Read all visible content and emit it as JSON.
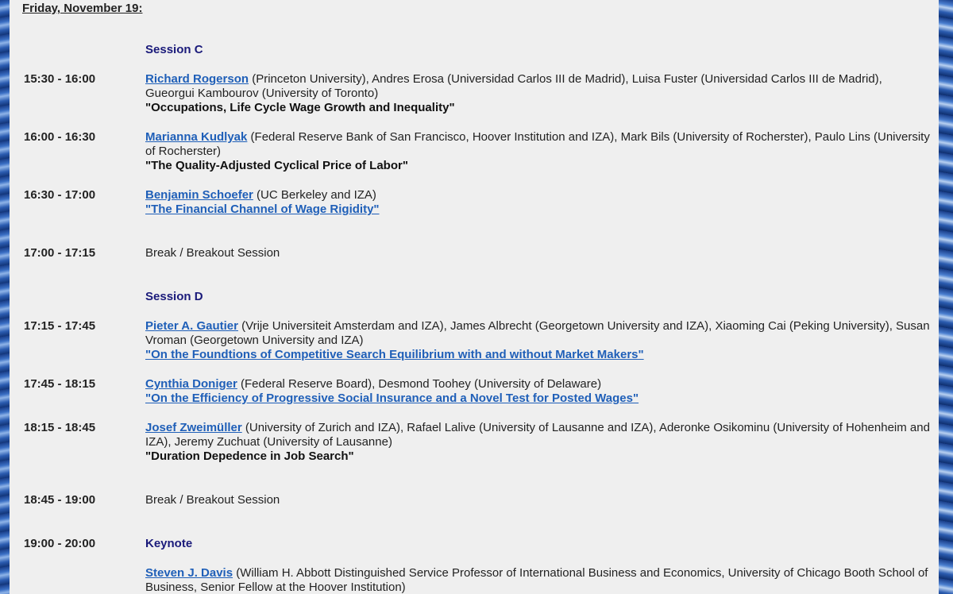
{
  "day_heading": "Friday, November 19:",
  "session_c": {
    "label": "Session C"
  },
  "talks_c": [
    {
      "time": "15:30 - 16:00",
      "speaker": "Richard Rogerson",
      "affiliation": " (Princeton University), Andres Erosa (Universidad Carlos III de Madrid), Luisa Fuster (Universidad Carlos III de Madrid), Gueorgui Kambourov (University of Toronto)",
      "title": "\"Occupations, Life Cycle Wage Growth and Inequality\""
    },
    {
      "time": "16:00 - 16:30",
      "speaker": "Marianna Kudlyak",
      "affiliation": " (Federal Reserve Bank of San Francisco, Hoover Institution and IZA), Mark Bils (University of Rocherster), Paulo Lins (University of Rocherster)",
      "title": "\"The Quality-Adjusted Cyclical Price of Labor\""
    },
    {
      "time": "16:30 - 17:00",
      "speaker": "Benjamin Schoefer",
      "affiliation": " (UC Berkeley and IZA)",
      "title": "\"The Financial Channel of Wage Rigidity\""
    }
  ],
  "break_1": {
    "time": "17:00 - 17:15",
    "label": "Break / Breakout Session"
  },
  "session_d": {
    "label": "Session D"
  },
  "talks_d": [
    {
      "time": "17:15 - 17:45",
      "speaker": "Pieter A. Gautier",
      "affiliation": " (Vrije Universiteit Amsterdam and IZA), James Albrecht (Georgetown University and IZA), Xiaoming Cai (Peking University), Susan Vroman (Georgetown University and IZA)",
      "title": "\"On the Foundtions of Competitive Search Equilibrium with and without Market Makers\""
    },
    {
      "time": "17:45 - 18:15",
      "speaker": "Cynthia Doniger",
      "affiliation": " (Federal Reserve Board), Desmond Toohey (University of Delaware)",
      "title": "\"On the Efficiency of Progressive Social Insurance and a Novel Test for Posted Wages\""
    },
    {
      "time": "18:15 - 18:45",
      "speaker": "Josef Zweimüller",
      "affiliation": " (University of Zurich and IZA), Rafael Lalive (University of Lausanne and IZA), Aderonke Osikominu (University of Hohenheim and IZA), Jeremy Zuchuat (University of Lausanne)",
      "title": "\"Duration Depedence in Job Search\""
    }
  ],
  "break_2": {
    "time": "18:45 - 19:00",
    "label": "Break / Breakout Session"
  },
  "keynote": {
    "time": "19:00 - 20:00",
    "label": "Keynote",
    "speaker": "Steven J. Davis",
    "affiliation": " (William H. Abbott Distinguished Service Professor of International Business and Economics, University of Chicago Booth School of Business, Senior Fellow at the Hoover Institution)"
  },
  "colors": {
    "link": "#1f5fb8",
    "session_label": "#1a1a7a",
    "page_bg": "#efefef"
  }
}
